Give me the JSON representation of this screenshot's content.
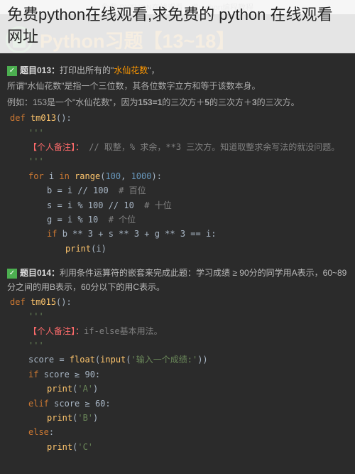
{
  "header_faint": "免费 PYTHON在线观看，求python编程教程",
  "overlay": "免费python在线观看,求免费的 python 在线观看网址",
  "main_title": "Python习题【13~18】",
  "q013": {
    "label": "题目013：",
    "text1": "打印出所有的\"",
    "highlight": "水仙花数",
    "text2": "\"，",
    "desc1": "所谓\"水仙花数\"是指一个三位数，其各位数字立方和等于该数本身。",
    "desc2_a": "例如：153是一个\"水仙花数\"，因为",
    "desc2_b": "153=1",
    "desc2_c": "的三次方＋",
    "desc2_d": "5",
    "desc2_e": "的三次方＋",
    "desc2_f": "3",
    "desc2_g": "的三次方。"
  },
  "code013": {
    "def": "def",
    "fname": "tm013",
    "triple": "'''",
    "note_label": "【个人备注】：",
    "note_text": " //  取整，% 求余，**3  三次方。知道取整求余写法的就没问题。",
    "for": "for",
    "i": "i",
    "in": "in",
    "range": "range",
    "r1": "100",
    "r2": "1000",
    "b_line": "b = i  //  100",
    "b_cmt": "# 百位",
    "s_line": "s = i % 100  //  10",
    "s_cmt": "# 十位",
    "g_line": "g = i % 10",
    "g_cmt": "# 个位",
    "if": "if",
    "cond": "b ** 3 + s ** 3 + g ** 3 == i:",
    "print": "print",
    "arg": "i"
  },
  "q014": {
    "label": "题目014：",
    "text": "利用条件运算符的嵌套来完成此题：学习成绩 ≥ 90分的同学用A表示，60~89分之间的用B表示，60分以下的用C表示。"
  },
  "code014": {
    "def": "def",
    "fname": "tm015",
    "triple": "'''",
    "note_label": "【个人备注】：",
    "note_text": "if-else",
    "note_text2": "基本用法。",
    "score": "score = ",
    "float": "float",
    "input": "input",
    "prompt": "'输入一个成绩:'",
    "if": "if",
    "c1": "score  ≥  90:",
    "pa": "'A'",
    "elif": "elif",
    "c2": "score  ≥  60:",
    "pb": "'B'",
    "else": "else",
    "pc": "'C'",
    "print": "print"
  }
}
